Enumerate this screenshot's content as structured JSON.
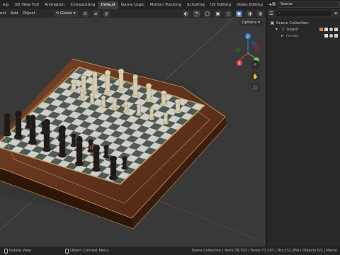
{
  "workspace_tabs": [
    {
      "label": "elp",
      "active": false
    },
    {
      "label": "3D View Full",
      "active": false
    },
    {
      "label": "Animation",
      "active": false
    },
    {
      "label": "Compositing",
      "active": false
    },
    {
      "label": "Default",
      "active": true
    },
    {
      "label": "Game Logic",
      "active": false
    },
    {
      "label": "Motion Tracking",
      "active": false
    },
    {
      "label": "Scripting",
      "active": false
    },
    {
      "label": "UV Editing",
      "active": false
    },
    {
      "label": "Video Editing",
      "active": false
    }
  ],
  "workspace_add": "+",
  "scene": {
    "name": "Scene"
  },
  "viewport_header": {
    "menu_view": "ect",
    "menu_add": "Add",
    "menu_object": "Object",
    "orientation": "Global"
  },
  "viewport": {
    "options_label": "Options"
  },
  "outliner": {
    "search_placeholder": "",
    "collection": "Scene Collection",
    "items": [
      {
        "label": "board",
        "type": "mesh"
      },
      {
        "label": "render",
        "type": "camera"
      }
    ]
  },
  "statusbar": {
    "left": "Rotate View",
    "center": "Object Context Menu",
    "stats": "Scene Collection | Verts:78,702 | Faces:77,197 | Tris:151,954 | Objects:0/2 | Memo"
  },
  "colors": {
    "accent": "#4772b3",
    "active_tab": "#3d3d3d",
    "viewport_bg": "#393939",
    "board_frame": "#6a3a22",
    "axis_x": "#e04a5a",
    "axis_y": "#6ac24a",
    "axis_z": "#3c7fe0"
  }
}
